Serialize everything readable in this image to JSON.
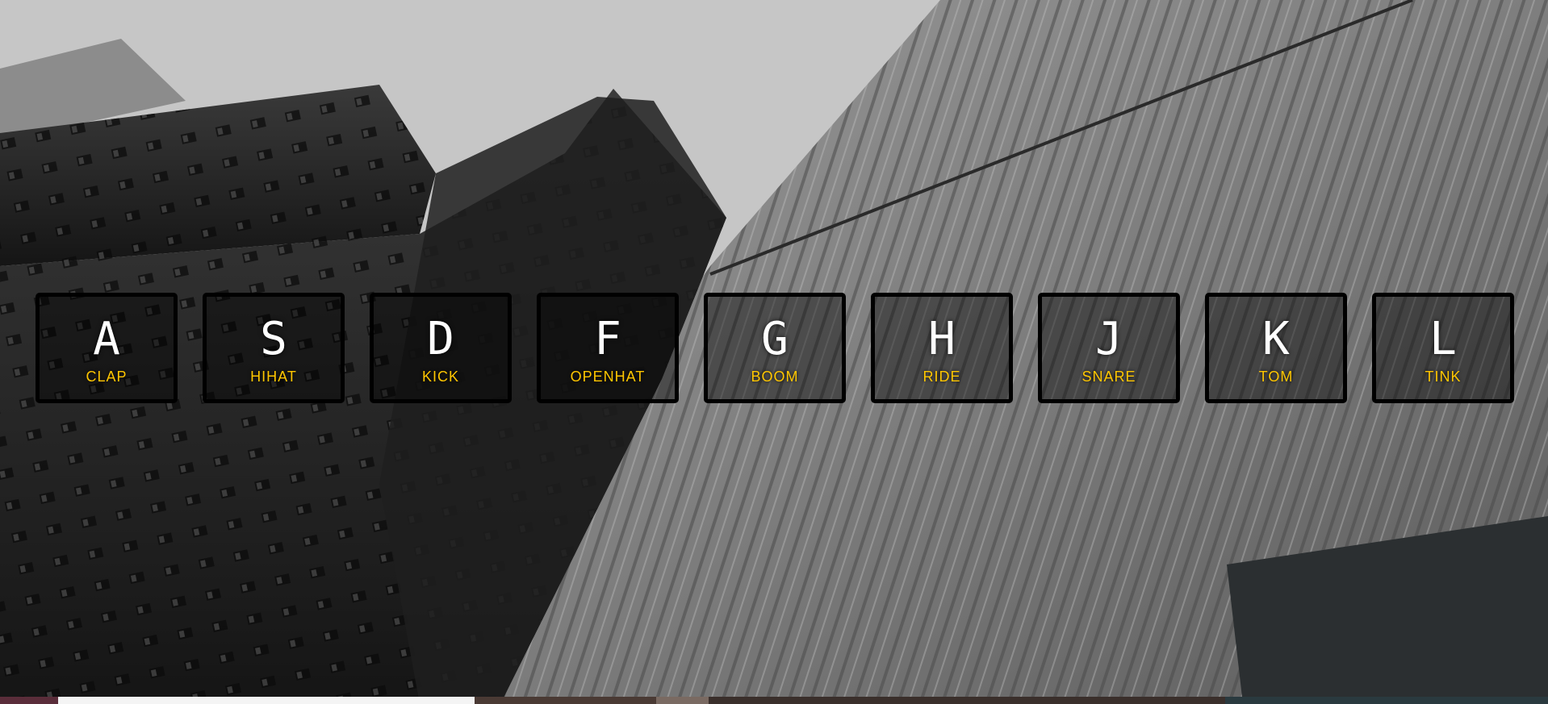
{
  "drum_kit": {
    "keys": [
      {
        "letter": "A",
        "sound": "CLAP"
      },
      {
        "letter": "S",
        "sound": "HIHAT"
      },
      {
        "letter": "D",
        "sound": "KICK"
      },
      {
        "letter": "F",
        "sound": "OPENHAT"
      },
      {
        "letter": "G",
        "sound": "BOOM"
      },
      {
        "letter": "H",
        "sound": "RIDE"
      },
      {
        "letter": "J",
        "sound": "SNARE"
      },
      {
        "letter": "K",
        "sound": "TOM"
      },
      {
        "letter": "L",
        "sound": "TINK"
      }
    ]
  },
  "colors": {
    "key_border": "#000000",
    "letter": "#ffffff",
    "sound_label": "#ffc600"
  },
  "background": {
    "icon": "skyscrapers-photo"
  }
}
